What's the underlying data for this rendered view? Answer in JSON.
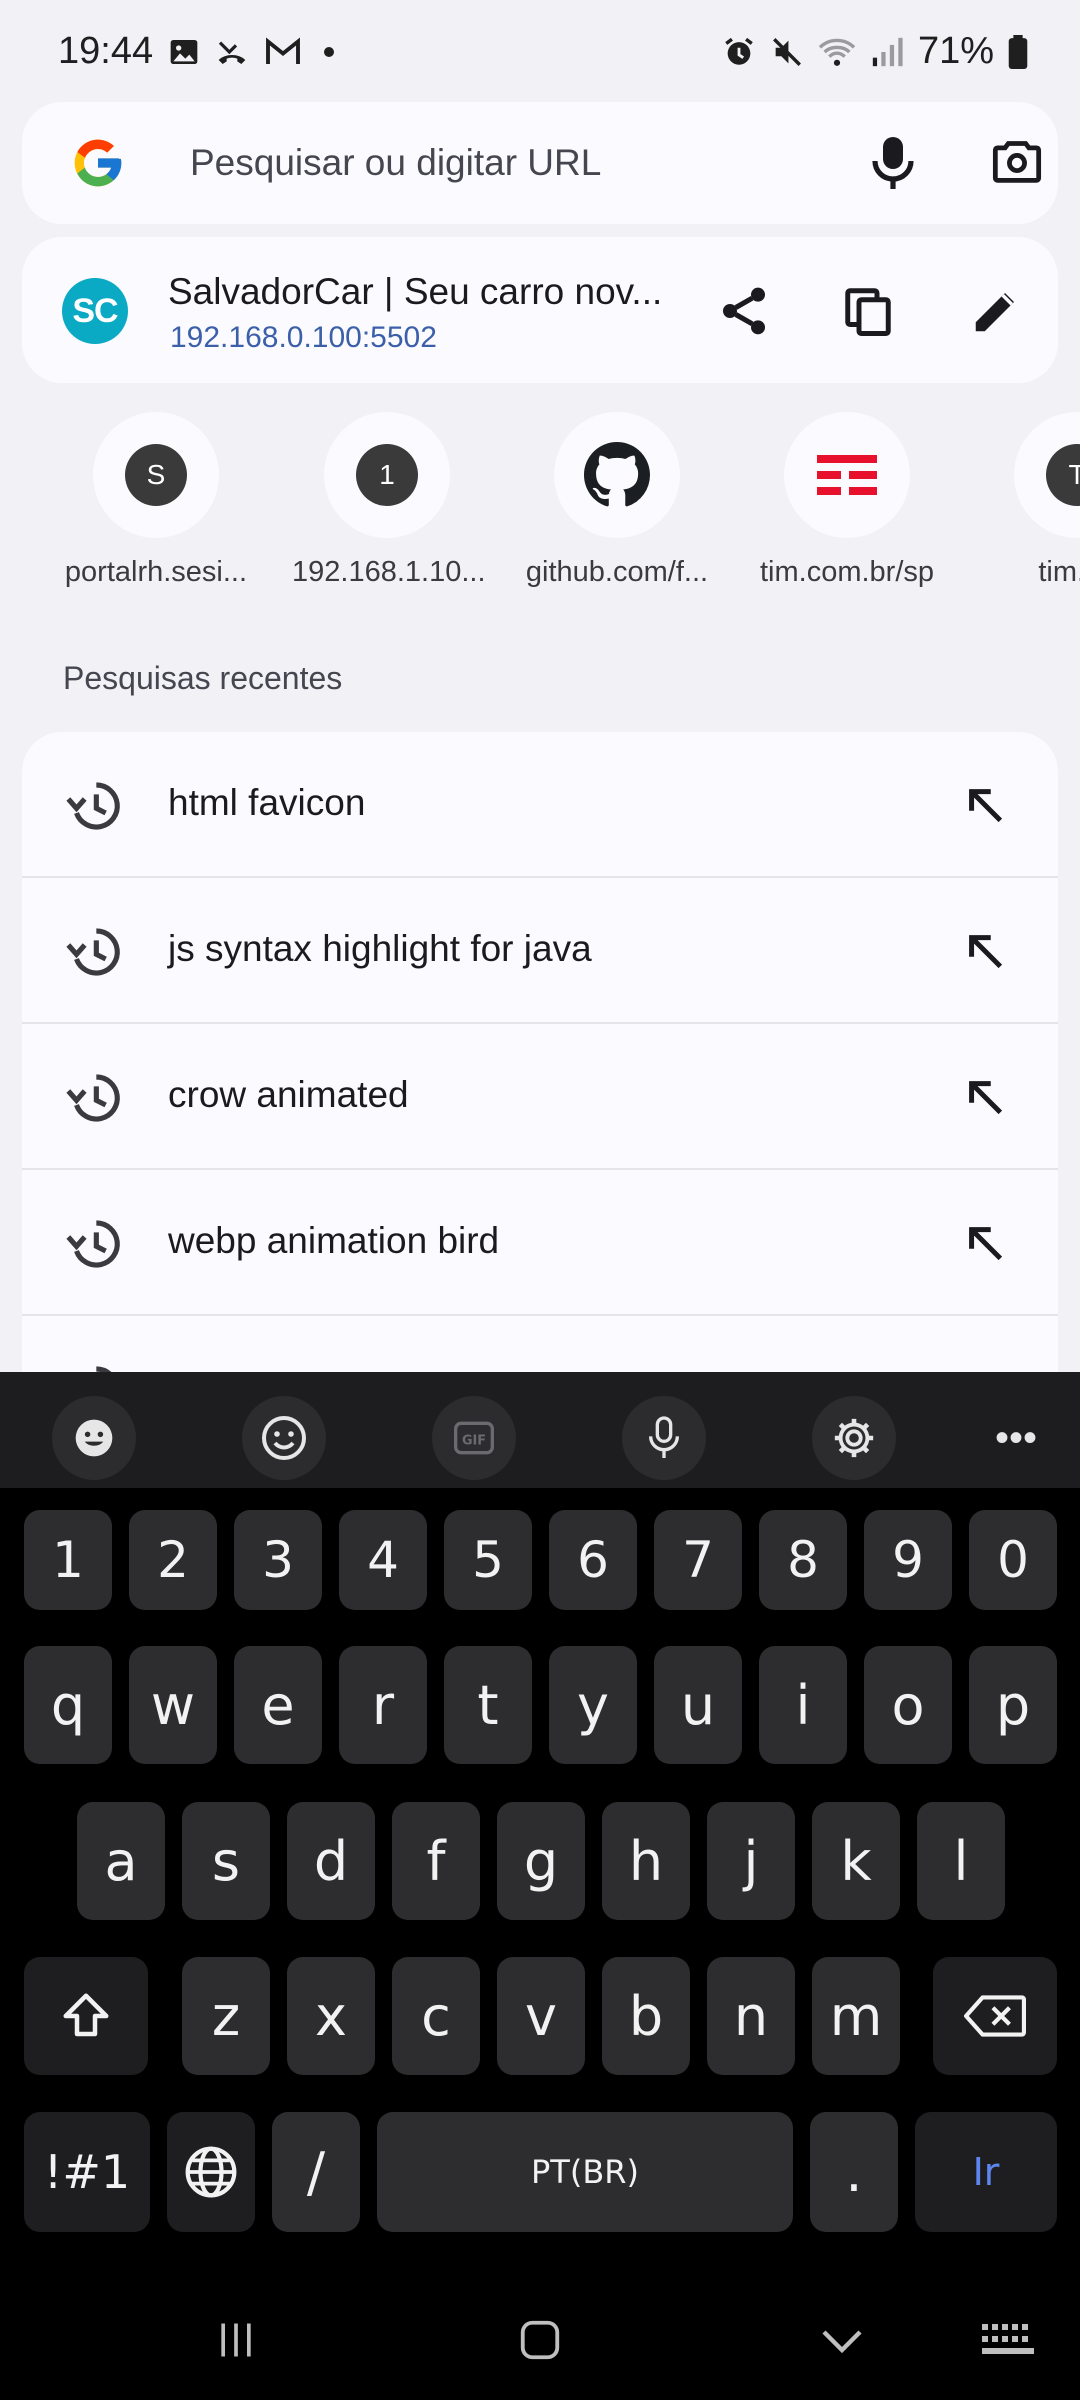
{
  "status": {
    "time": "19:44",
    "battery": "71%"
  },
  "search": {
    "placeholder": "Pesquisar ou digitar URL"
  },
  "current_page": {
    "favicon_text": "SC",
    "title": "SalvadorCar | Seu carro nov...",
    "url": "192.168.0.100:5502"
  },
  "shortcuts": [
    {
      "icon_text": "S",
      "label": "portalrh.sesi..."
    },
    {
      "icon_text": "1",
      "label": "192.168.1.10..."
    },
    {
      "icon_text": "github-icon",
      "label": "github.com/f..."
    },
    {
      "icon_text": "tim-icon",
      "label": "tim.com.br/sp"
    },
    {
      "icon_text": "T",
      "label": "tim.co"
    }
  ],
  "recent": {
    "header": "Pesquisas recentes",
    "items": [
      "html favicon",
      "js syntax highlight for java",
      "crow animated",
      "webp animation bird"
    ]
  },
  "keyboard": {
    "numbers": [
      "1",
      "2",
      "3",
      "4",
      "5",
      "6",
      "7",
      "8",
      "9",
      "0"
    ],
    "row1": [
      "q",
      "w",
      "e",
      "r",
      "t",
      "y",
      "u",
      "i",
      "o",
      "p"
    ],
    "row2": [
      "a",
      "s",
      "d",
      "f",
      "g",
      "h",
      "j",
      "k",
      "l"
    ],
    "row3": [
      "z",
      "x",
      "c",
      "v",
      "b",
      "n",
      "m"
    ],
    "symbols_key": "!#1",
    "slash_key": "/",
    "space_label": "PT(BR)",
    "period_key": ".",
    "go_key": "Ir"
  },
  "colors": {
    "accent_blue": "#3b5fa8",
    "favicon_teal": "#0aa9c4",
    "tim_red": "#e8112d",
    "go_key_blue": "#5d86f0"
  }
}
